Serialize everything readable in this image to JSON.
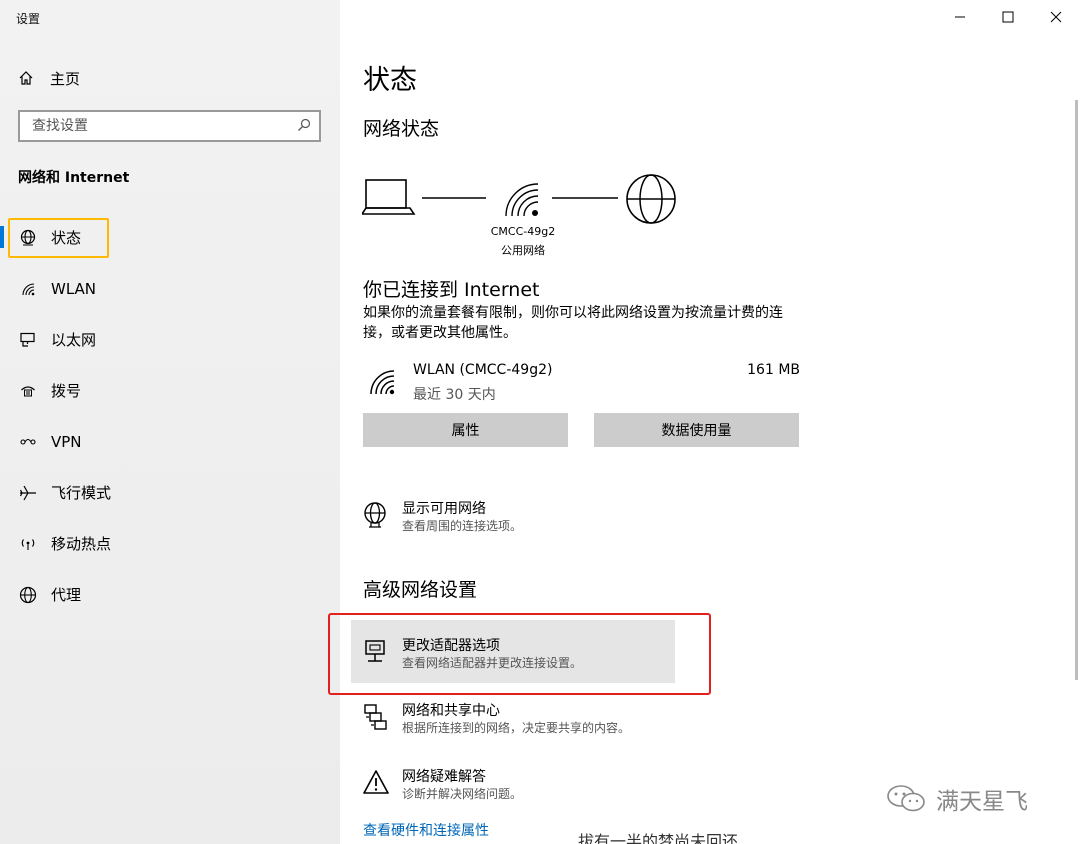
{
  "app": {
    "title": "设置"
  },
  "sidebar": {
    "home_label": "主页",
    "search_placeholder": "查找设置",
    "section_title": "网络和 Internet",
    "items": [
      {
        "label": "状态",
        "icon": "globe-status-icon",
        "active": true
      },
      {
        "label": "WLAN",
        "icon": "wifi-icon"
      },
      {
        "label": "以太网",
        "icon": "ethernet-icon"
      },
      {
        "label": "拨号",
        "icon": "dialup-icon"
      },
      {
        "label": "VPN",
        "icon": "vpn-icon"
      },
      {
        "label": "飞行模式",
        "icon": "airplane-icon"
      },
      {
        "label": "移动热点",
        "icon": "hotspot-icon"
      },
      {
        "label": "代理",
        "icon": "globe-icon"
      }
    ]
  },
  "main": {
    "title": "状态",
    "network_status_heading": "网络状态",
    "network": {
      "ssid": "CMCC-49g2",
      "type": "公用网络"
    },
    "connected_title": "你已连接到 Internet",
    "connected_desc": "如果你的流量套餐有限制，则你可以将此网络设置为按流量计费的连接，或者更改其他属性。",
    "adapter": {
      "name": "WLAN (CMCC-49g2)",
      "period": "最近 30 天内",
      "usage": "161 MB"
    },
    "buttons": {
      "properties": "属性",
      "data_usage": "数据使用量"
    },
    "show_networks": {
      "title": "显示可用网络",
      "desc": "查看周围的连接选项。"
    },
    "advanced_heading": "高级网络设置",
    "advanced_items": [
      {
        "title": "更改适配器选项",
        "desc": "查看网络适配器并更改连接设置。",
        "icon": "adapter-icon"
      },
      {
        "title": "网络和共享中心",
        "desc": "根据所连接到的网络，决定要共享的内容。",
        "icon": "sharing-center-icon"
      },
      {
        "title": "网络疑难解答",
        "desc": "诊断并解决网络问题。",
        "icon": "warning-icon"
      }
    ],
    "hardware_link": "查看硬件和连接属性"
  },
  "overlay": {
    "caption": "拔有一半的梦尚未回还",
    "watermark": "满天星飞"
  },
  "colors": {
    "accent": "#0078d7",
    "highlight_yellow": "#ffb900",
    "highlight_red": "#e51e1e",
    "link": "#0067b8"
  }
}
